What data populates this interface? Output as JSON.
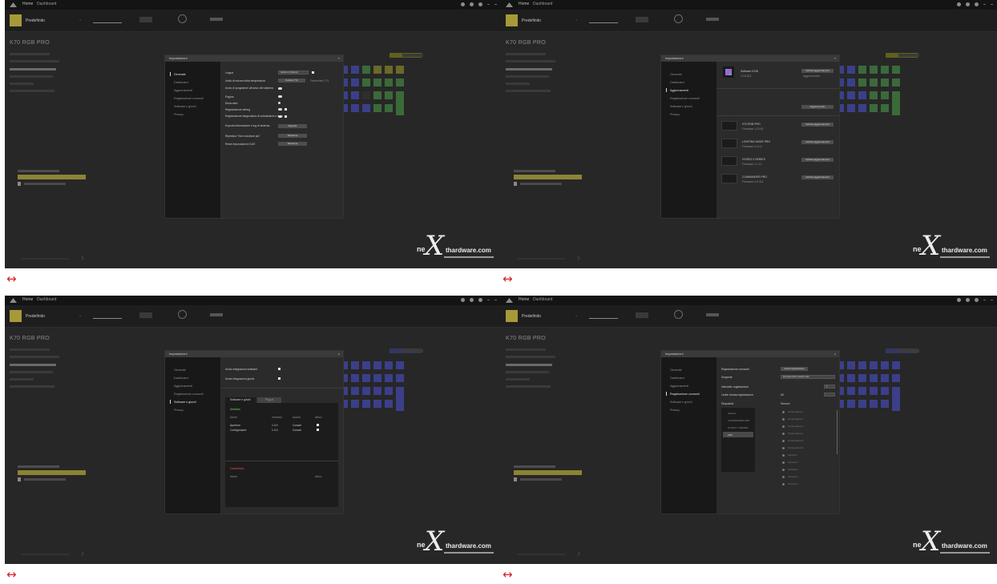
{
  "app": {
    "nav_home": "Home",
    "nav_dashboard": "Dashboard",
    "profile": "Predefinito",
    "device_title": "K70 RGB PRO",
    "colors": {
      "accent": "#a59a38",
      "background": "#272727",
      "modal": "#2b2b2b",
      "arrow": "#d32424"
    }
  },
  "arrow_glyph": "↔",
  "watermark": {
    "prefix": "ne",
    "x": "X",
    "suffix": "thardware.com"
  },
  "modal": {
    "title": "Impostazioni",
    "close": "×",
    "nav": [
      "Generale",
      "Dashboard",
      "Aggiornamenti",
      "Registrazione comandi",
      "Software e giochi",
      "Privacy"
    ]
  },
  "panel1": {
    "rows": [
      "Lingua",
      "Unità di misura della temperatura",
      "Avvio di programmi all'avvio del sistema",
      "Pagina",
      "Modo daic",
      "Registrazione debug",
      "Registrazione diagnostica di sottosistemi e invio",
      "Esporta informazioni e log di sistema",
      "Ripristina \"Non mostrare più\"",
      "Reset impostazioni iCUE"
    ],
    "language_value": "Italiano (Italiano)",
    "temp_c": "Celsius (°C)",
    "temp_f": "Fahrenheit (°F)",
    "export_btn": "Esporta",
    "restore_btn": "Ripristina",
    "reset_btn": "Ripristina"
  },
  "panel2": {
    "software": "Software iCUE",
    "version": "4.15.153",
    "check_btn": "Verifica aggiornamenti",
    "check_btn2": "Aggiorna tutto",
    "devices": [
      {
        "name": "K70 RGB PRO",
        "sub": "Firmware 1.15.40"
      },
      {
        "name": "LIGHTING NODE PRO",
        "sub": "Firmware 0.10.4"
      },
      {
        "name": "HYDRO X SERIES",
        "sub": "Firmware 1.1.12"
      },
      {
        "name": "COMMANDER PRO",
        "sub": "Firmware 0.9.214"
      }
    ],
    "device_btn": "Verifica aggiornamenti"
  },
  "panel3": {
    "row1": "Avvia integrazioni software",
    "row2": "Avvia integrazioni giochi",
    "tab_active": "Software e giochi",
    "tab_other": "Plug-in",
    "enabled_header": "Abilitato",
    "cols": [
      "Nome",
      "Versione",
      "Autore",
      "Attivo"
    ],
    "items": [
      {
        "name": "Aperture",
        "ver": "1.0.0",
        "author": "Corsair"
      },
      {
        "name": "Configuratore",
        "ver": "1.0.0",
        "author": "Corsair"
      }
    ],
    "disabled_header": "Disabilitato",
    "disabled_cols": [
      "Nome",
      "Attivo"
    ]
  },
  "panel4": {
    "record_label": "Registrazione comandi",
    "record_value": "Avvia registrazione",
    "source_label": "Sorgente",
    "source_value": "Da dispositivi selezionati",
    "interval_label": "Intervallo registrazione",
    "time_label": "Limite durata registrazione",
    "devices_label": "Dispositivi",
    "sensors_label": "Sensori",
    "device_list": [
      "Tastiera",
      "COMMANDER PRO",
      "HYDRO X SERIES",
      "CPU"
    ],
    "sensor_list": [
      "Temperatura 1",
      "Temperatura 2",
      "Temperatura 3",
      "Temperatura 4",
      "Temperatura 5",
      "Temperatura 6",
      "Ventola 1",
      "Ventola 2",
      "Ventola 3",
      "Ventola 4",
      "Ventola 5"
    ],
    "interval_value": "1",
    "time_value": "60"
  }
}
